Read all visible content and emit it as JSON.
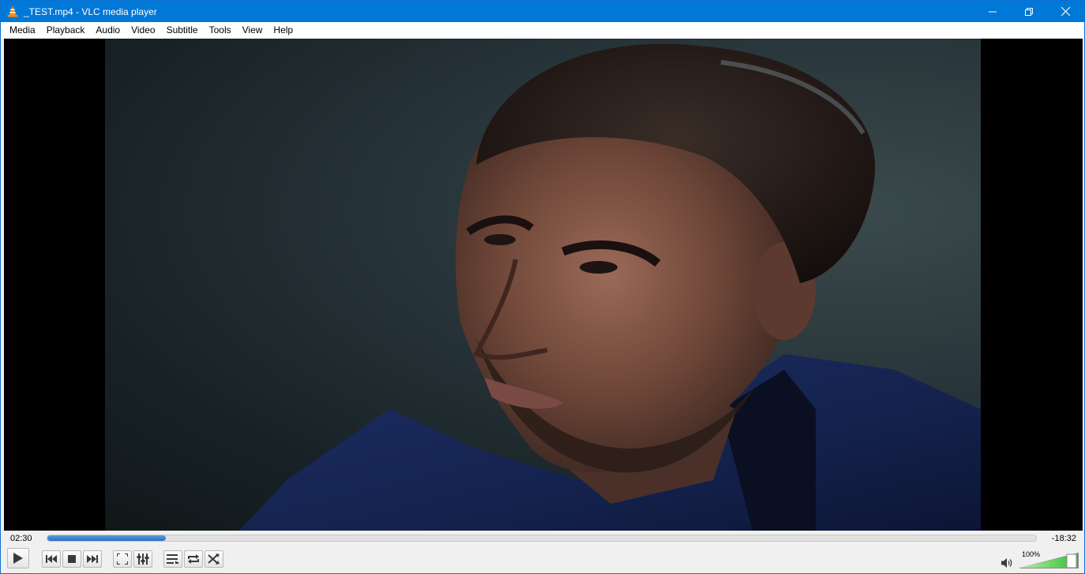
{
  "window": {
    "title": "_TEST.mp4 - VLC media player"
  },
  "menu": [
    {
      "label": "Media"
    },
    {
      "label": "Playback"
    },
    {
      "label": "Audio"
    },
    {
      "label": "Video"
    },
    {
      "label": "Subtitle"
    },
    {
      "label": "Tools"
    },
    {
      "label": "View"
    },
    {
      "label": "Help"
    }
  ],
  "playback": {
    "elapsed": "02:30",
    "remaining": "-18:32",
    "progress_fraction": 0.12
  },
  "controls": {
    "icons": [
      "play-icon",
      "previous-icon",
      "stop-icon",
      "next-icon",
      "fullscreen-icon",
      "extended-settings-icon",
      "playlist-icon",
      "loop-icon",
      "shuffle-icon",
      "volume-icon"
    ]
  },
  "volume": {
    "level_label": "100%",
    "fraction": 1.0
  },
  "colors": {
    "titlebar": "#0078d7",
    "seek_fill": "#2a6fc0",
    "volume_fill": "#3cc83c"
  }
}
